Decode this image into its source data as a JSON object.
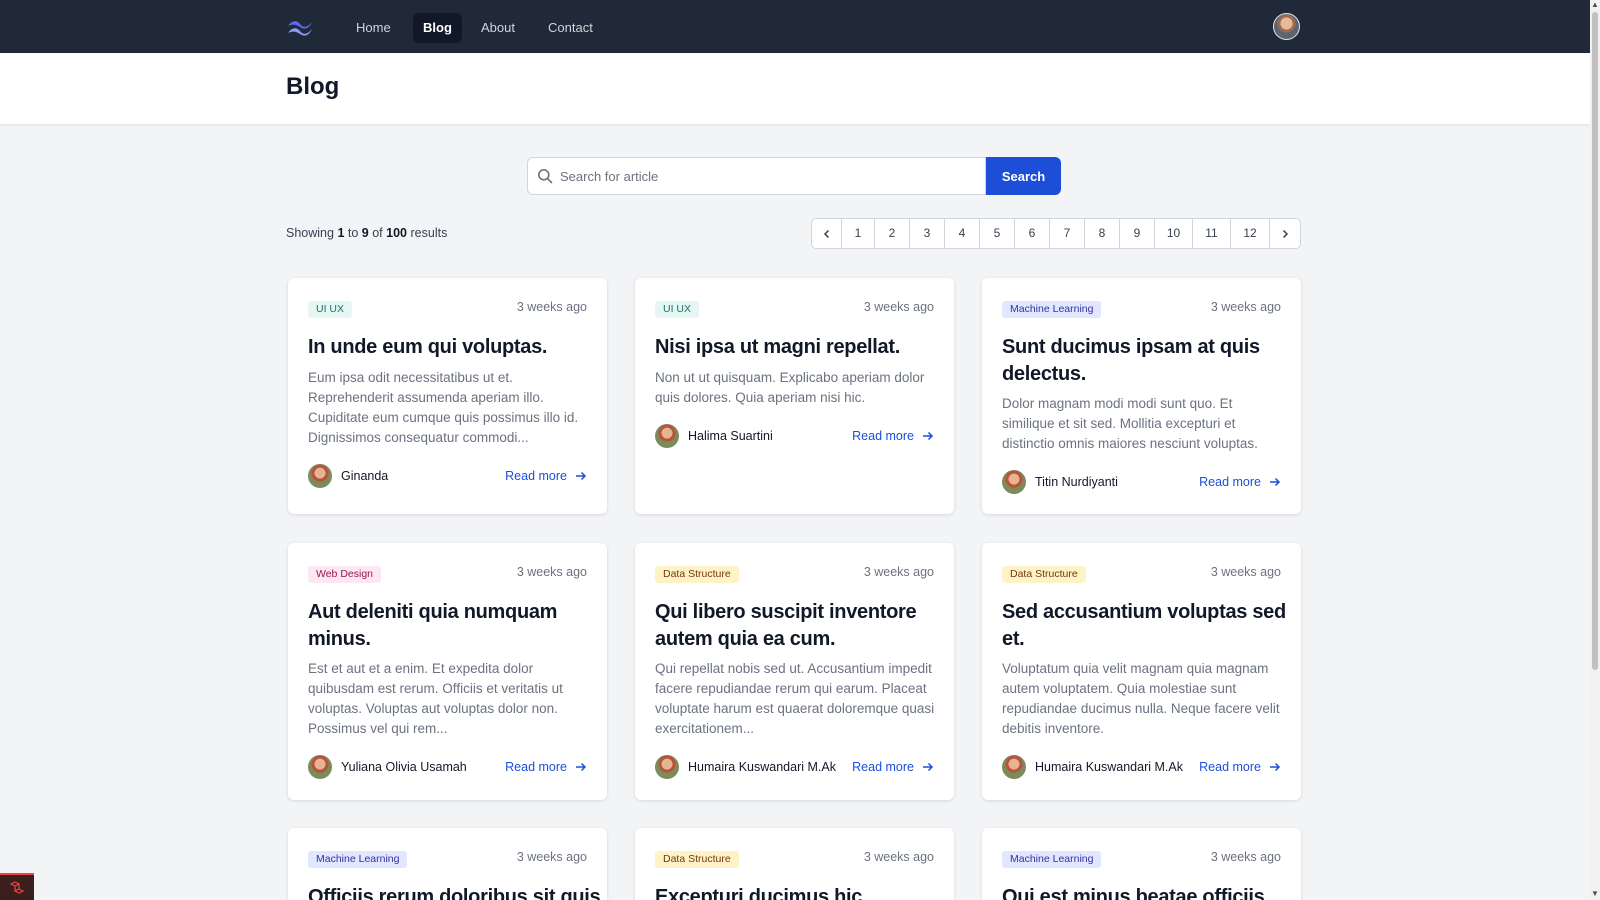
{
  "nav": {
    "logo_icon": "tailwind-wave-logo",
    "links": [
      {
        "label": "Home",
        "active": false
      },
      {
        "label": "Blog",
        "active": true
      },
      {
        "label": "About",
        "active": false
      },
      {
        "label": "Contact",
        "active": false
      }
    ],
    "user_avatar_icon": "user-avatar"
  },
  "header": {
    "title": "Blog"
  },
  "search": {
    "placeholder": "Search for article",
    "value": "",
    "button_label": "Search"
  },
  "results": {
    "prefix": "Showing",
    "from": "1",
    "to_word": "to",
    "to": "9",
    "of_word": "of",
    "total": "100",
    "suffix": "results"
  },
  "pagination": {
    "prev_icon": "chevron-left-icon",
    "next_icon": "chevron-right-icon",
    "pages": [
      "1",
      "2",
      "3",
      "4",
      "5",
      "6",
      "7",
      "8",
      "9",
      "10",
      "11",
      "12"
    ]
  },
  "read_more_label": "Read more",
  "posts": [
    {
      "category": "UI UX",
      "time": "3 weeks ago",
      "title": "In unde eum qui voluptas.",
      "excerpt": "Eum ipsa odit necessitatibus ut et. Reprehenderit assumenda aperiam illo. Cupiditate eum cumque quis possimus illo id. Dignissimos consequatur commodi...",
      "author": "Ginanda"
    },
    {
      "category": "UI UX",
      "time": "3 weeks ago",
      "title": "Nisi ipsa ut magni repellat.",
      "excerpt": "Non ut ut quisquam. Explicabo aperiam dolor quis dolores. Quia aperiam nisi hic.",
      "author": "Halima Suartini"
    },
    {
      "category": "Machine Learning",
      "time": "3 weeks ago",
      "title": "Sunt ducimus ipsam at quis delectus.",
      "excerpt": "Dolor magnam modi modi sunt quo. Et similique et sit sed. Mollitia excepturi et distinctio omnis maiores nesciunt voluptas.",
      "author": "Titin Nurdiyanti"
    },
    {
      "category": "Web Design",
      "time": "3 weeks ago",
      "title": "Aut deleniti quia numquam minus.",
      "excerpt": "Est et aut et a enim. Et expedita dolor quibusdam est rerum. Officiis et veritatis ut voluptas. Voluptas aut voluptas dolor non. Possimus vel qui rem...",
      "author": "Yuliana Olivia Usamah"
    },
    {
      "category": "Data Structure",
      "time": "3 weeks ago",
      "title": "Qui libero suscipit inventore autem quia ea cum.",
      "excerpt": "Qui repellat nobis sed ut. Accusantium impedit facere repudiandae rerum qui earum. Placeat voluptate harum est quaerat doloremque quasi exercitationem...",
      "author": "Humaira Kuswandari M.Ak"
    },
    {
      "category": "Data Structure",
      "time": "3 weeks ago",
      "title": "Sed accusantium voluptas sed et.",
      "excerpt": "Voluptatum quia velit magnam quia magnam autem voluptatem. Quia molestiae sunt repudiandae ducimus nulla. Neque facere velit debitis inventore.",
      "author": "Humaira Kuswandari M.Ak"
    },
    {
      "category": "Machine Learning",
      "time": "3 weeks ago",
      "title": "Officiis rerum doloribus sit quis",
      "excerpt": "",
      "author": ""
    },
    {
      "category": "Data Structure",
      "time": "3 weeks ago",
      "title": "Excepturi ducimus hic",
      "excerpt": "",
      "author": ""
    },
    {
      "category": "Machine Learning",
      "time": "3 weeks ago",
      "title": "Qui est minus beatae officiis",
      "excerpt": "",
      "author": ""
    }
  ],
  "colors": {
    "navbar": "#1f2937",
    "accent": "#1d4ed8",
    "background": "#f3f4f6"
  }
}
